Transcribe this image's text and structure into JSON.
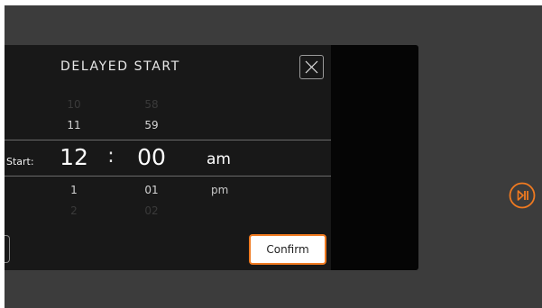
{
  "dialog": {
    "title": "DELAYED START",
    "start_label": "Start:",
    "separator": ":",
    "confirm_label": "Confirm"
  },
  "picker": {
    "hours": {
      "prev2": "10",
      "prev1": "11",
      "selected": "12",
      "next1": "1",
      "next2": "2"
    },
    "minutes": {
      "prev2": "58",
      "prev1": "59",
      "selected": "00",
      "next1": "01",
      "next2": "02"
    },
    "meridiem": {
      "selected": "am",
      "next1": "pm"
    }
  },
  "icons": {
    "close": "close-icon",
    "play_pause": "play-pause-icon"
  },
  "colors": {
    "accent": "#f07a20",
    "background": "#3c3c3c",
    "dialog": "#181818"
  }
}
